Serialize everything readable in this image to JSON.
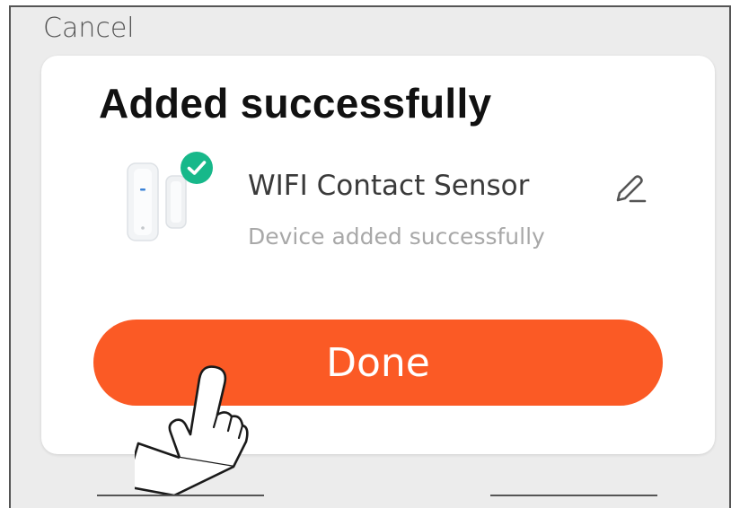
{
  "header": {
    "cancel_label": "Cancel"
  },
  "dialog": {
    "title": "Added successfully",
    "device": {
      "name": "WIFI Contact Sensor",
      "status": "Device added successfully",
      "image_icon": "contact-sensor-image",
      "badge_icon": "check-circle-icon",
      "edit_icon": "pencil-icon"
    },
    "done_label": "Done"
  },
  "colors": {
    "accent": "#fb5a25",
    "success": "#17b88a",
    "title": "#111111",
    "secondary_text": "#a8a8a8"
  }
}
